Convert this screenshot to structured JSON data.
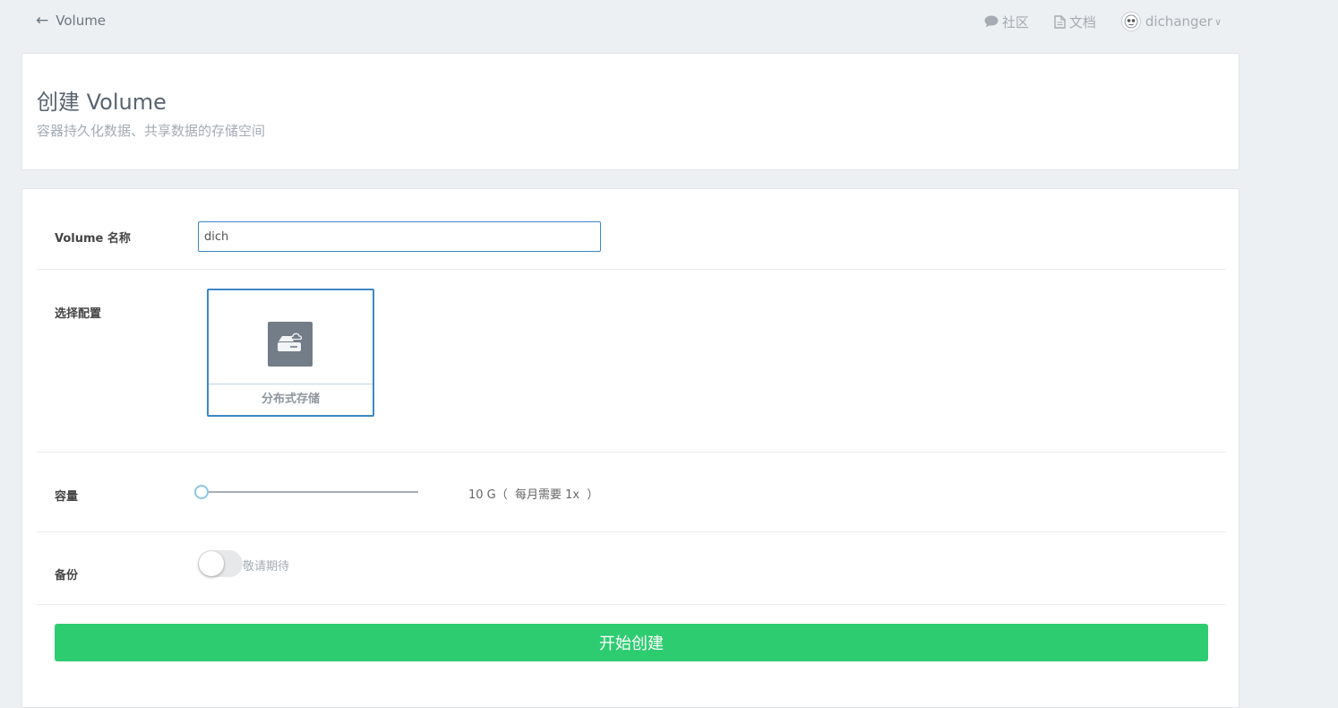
{
  "topbar": {
    "back_label": "Volume",
    "nav": {
      "community": "社区",
      "docs": "文档",
      "username": "dichanger"
    }
  },
  "header": {
    "title": "创建 Volume",
    "subtitle": "容器持久化数据、共享数据的存储空间"
  },
  "form": {
    "name": {
      "label": "Volume 名称",
      "value": "dich"
    },
    "config": {
      "label": "选择配置",
      "option_label": "分布式存储",
      "option_icon": "cloud-storage-icon"
    },
    "capacity": {
      "label": "容量",
      "value_text": "10 G（  每月需要 1x  ）",
      "slider_fraction": 0
    },
    "backup": {
      "label": "备份",
      "enabled": false,
      "note": "敬请期待"
    },
    "submit_label": "开始创建"
  },
  "colors": {
    "accent_blue": "#3e88c6",
    "submit_green": "#2ecc71",
    "background": "#edf0f2"
  }
}
